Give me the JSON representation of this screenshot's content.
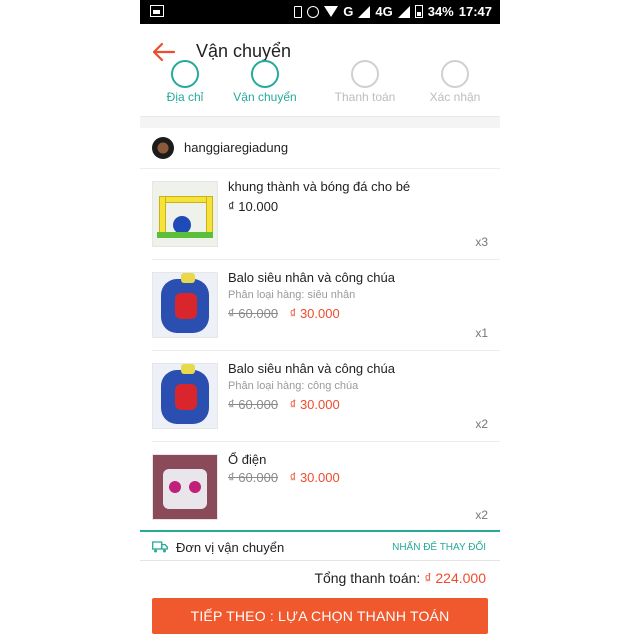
{
  "status_bar": {
    "network": "G",
    "network2": "4G",
    "battery": "34%",
    "time": "17:47"
  },
  "header": {
    "title": "Vận chuyển"
  },
  "steps": [
    {
      "label": "Địa chỉ",
      "state": "done"
    },
    {
      "label": "Vận chuyển",
      "state": "active"
    },
    {
      "label": "Thanh toán",
      "state": "inactive"
    },
    {
      "label": "Xác nhận",
      "state": "inactive"
    }
  ],
  "shop": {
    "name": "hanggiaregiadung"
  },
  "items": [
    {
      "name": "khung thành và bóng đá cho bé",
      "variant": "",
      "old_price": "",
      "price": "₫ 10.000",
      "qty": "x3"
    },
    {
      "name": "Balo siêu nhân và công chúa",
      "variant": "Phân loại hàng: siêu nhân",
      "old_price": "₫ 60.000",
      "price": "₫ 30.000",
      "qty": "x1"
    },
    {
      "name": "Balo siêu nhân và công chúa",
      "variant": "Phân loại hàng: công chúa",
      "old_price": "₫ 60.000",
      "price": "₫ 30.000",
      "qty": "x2"
    },
    {
      "name": "Ổ điện",
      "variant": "",
      "old_price": "₫ 60.000",
      "price": "₫ 30.000",
      "qty": "x2"
    }
  ],
  "shipping": {
    "label": "Đơn vị vận chuyển",
    "action": "NHẤN ĐỂ THAY ĐỔI"
  },
  "footer": {
    "total_label": "Tổng thanh toán:",
    "total_value": "₫ 224.000",
    "cta": "TIẾP THEO : LỰA CHỌN THANH TOÁN"
  },
  "colors": {
    "accent": "#26aa99",
    "price": "#ee4d2d",
    "cta": "#f0592e"
  }
}
